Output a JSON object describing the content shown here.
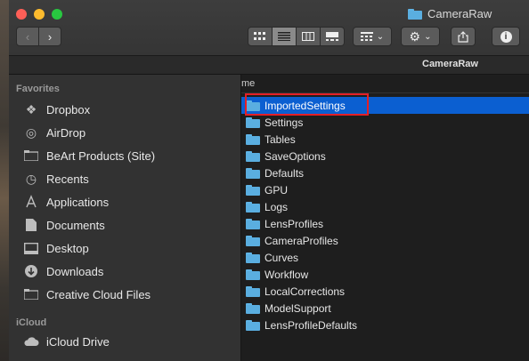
{
  "window": {
    "title": "CameraRaw"
  },
  "toolbar": {
    "back_label": "‹",
    "forward_label": "›",
    "view_modes": [
      "icon-view",
      "list-view",
      "column-view",
      "gallery-view"
    ],
    "active_view": "list-view"
  },
  "path_title": "CameraRaw",
  "sidebar": {
    "sections": [
      {
        "heading": "Favorites",
        "items": [
          {
            "label": "Dropbox",
            "icon": "dropbox-icon"
          },
          {
            "label": "AirDrop",
            "icon": "airdrop-icon"
          },
          {
            "label": "BeArt Products (Site)",
            "icon": "folder-icon"
          },
          {
            "label": "Recents",
            "icon": "clock-icon"
          },
          {
            "label": "Applications",
            "icon": "applications-icon"
          },
          {
            "label": "Documents",
            "icon": "document-icon"
          },
          {
            "label": "Desktop",
            "icon": "desktop-icon"
          },
          {
            "label": "Downloads",
            "icon": "download-icon"
          },
          {
            "label": "Creative Cloud Files",
            "icon": "folder-icon"
          }
        ]
      },
      {
        "heading": "iCloud",
        "items": [
          {
            "label": "iCloud Drive",
            "icon": "cloud-icon"
          }
        ]
      }
    ]
  },
  "list": {
    "column_header": "me",
    "rows": [
      "ImportedSettings",
      "Settings",
      "Tables",
      "SaveOptions",
      "Defaults",
      "GPU",
      "Logs",
      "LensProfiles",
      "CameraProfiles",
      "Curves",
      "Workflow",
      "LocalCorrections",
      "ModelSupport",
      "LensProfileDefaults"
    ],
    "selected_index": 0
  },
  "colors": {
    "selection": "#0b5fd1",
    "highlight_box": "#e41f26",
    "folder": "#5aaee0"
  }
}
